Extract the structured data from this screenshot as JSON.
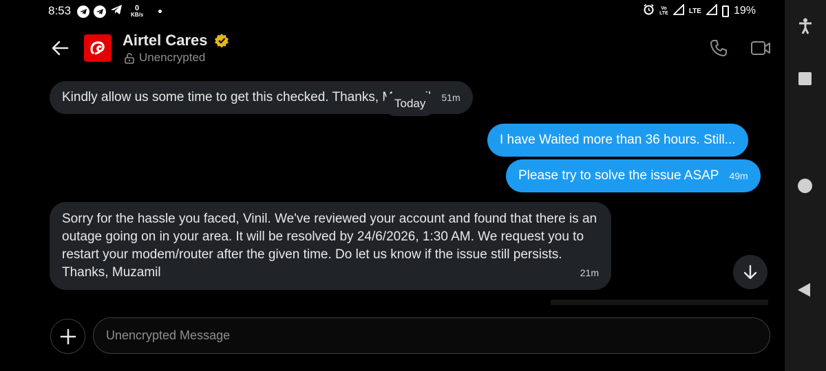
{
  "status_bar": {
    "time": "8:53",
    "speed_value": "0",
    "speed_unit": "KB/s",
    "volte": "Vo",
    "volte2": "LTE",
    "network": "LTE",
    "battery": "19%"
  },
  "header": {
    "contact_name": "Airtel Cares",
    "encryption_status": "Unencrypted",
    "accent_color": "#1d9bf0",
    "brand_color": "#e40000"
  },
  "messages": [
    {
      "direction": "incoming",
      "text": "Kindly allow us some time to get this checked. Thanks, Muzamil",
      "time": "51m"
    },
    {
      "direction": "outgoing",
      "text": "I have Waited more than 36 hours. Still...",
      "time": ""
    },
    {
      "direction": "outgoing",
      "text": "Please try to solve the issue ASAP",
      "time": "49m"
    },
    {
      "direction": "incoming",
      "text": "Sorry for the hassle you faced, Vinil. We've reviewed your account and found that there is an outage going on in your area. It will be resolved by 24/6/2026, 1:30 AM. We request you to restart your modem/router after the given time. Do let us know if the issue still persists. Thanks, Muzamil",
      "time": "21m"
    }
  ],
  "date_separator": "Today",
  "composer": {
    "placeholder": "Unencrypted Message"
  },
  "icons": {
    "back": "arrow-left-icon",
    "verified": "verified-badge-icon",
    "lock": "unlocked-icon",
    "call": "phone-icon",
    "video": "video-camera-icon",
    "scroll": "arrow-down-icon",
    "add": "plus-icon"
  }
}
